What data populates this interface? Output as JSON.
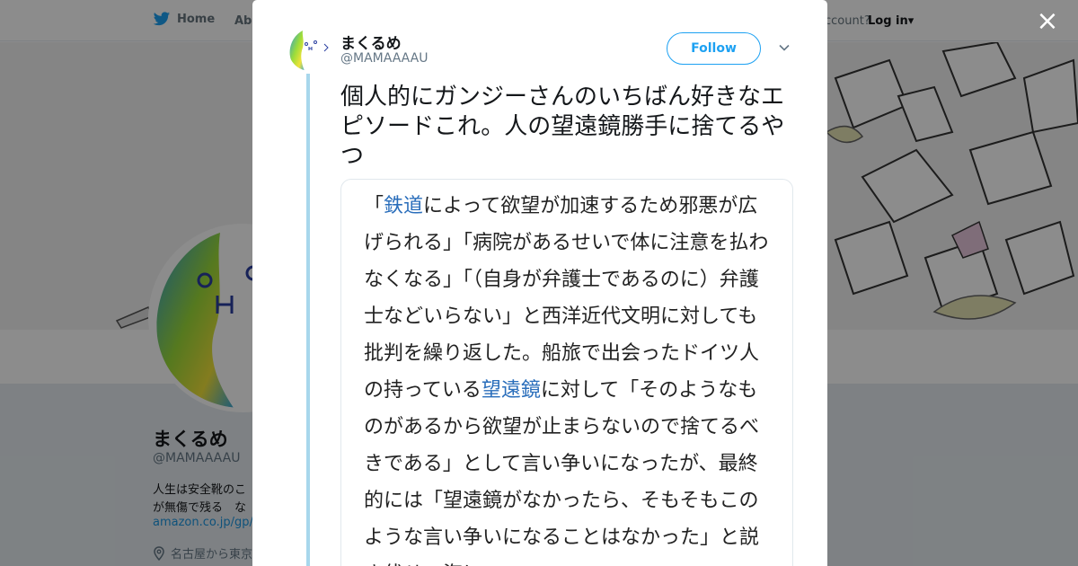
{
  "background": {
    "nav": {
      "home_label": "Home",
      "about_label": "Abo",
      "account_prompt": "ccount?",
      "login_label": "Log in▾"
    },
    "profile": {
      "name": "まくるめ",
      "handle": "@MAMAAAAU",
      "bio_line1": "人生は安全靴のこ",
      "bio_line2": "が無傷で残る　な",
      "link": "amazon.co.jp/gp/r",
      "location": "名古屋から東京"
    }
  },
  "modal": {
    "close_label": "×",
    "tweet": {
      "author_name": "まくるめ",
      "author_handle": "@MAMAAAAU",
      "follow_label": "Follow",
      "text": "個人的にガンジーさんのいちばん好きなエピソードこれ。人の望遠鏡勝手に捨てるやつ",
      "quote": {
        "seg1": "「",
        "link1": "鉄道",
        "seg2": "によって欲望が加速するため邪悪が広げられる」「病院があるせいで体に注意を払わなくなる」「（自身が弁護士であるのに）弁護士などいらない」と西洋近代文明に対しても批判を繰り返した。船旅で出会ったドイツ人の持っている",
        "link2": "望遠鏡",
        "seg3": "に対して「そのようなものがあるから欲望が止まらないので捨てるべきである」として言い争いになったが、最終的には「望遠鏡がなかったら、そもそもこのような言い争いになることはなかった」と説き伏せ、海に"
      }
    }
  },
  "colors": {
    "twitter_blue": "#1da1f2",
    "thread_line": "#a8d7ec",
    "link_blue": "#2a6ebb",
    "overlay": "rgba(0,0,0,0.45)"
  },
  "icons": {
    "nav_home": "twitter-bird-icon",
    "close": "close-icon",
    "more": "chevron-down-icon",
    "location": "location-pin-icon"
  }
}
